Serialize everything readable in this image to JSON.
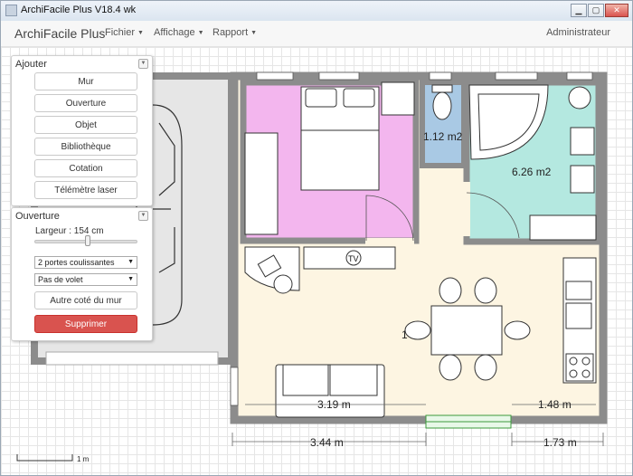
{
  "window": {
    "title": "ArchiFacile Plus V18.4 wk"
  },
  "navbar": {
    "brand": "ArchiFacile Plus",
    "menus": [
      "Fichier",
      "Affichage",
      "Rapport"
    ],
    "user": "Administrateur"
  },
  "panel_ajouter": {
    "title": "Ajouter",
    "buttons": [
      "Mur",
      "Ouverture",
      "Objet",
      "Bibliothèque",
      "Cotation",
      "Télémètre laser"
    ]
  },
  "panel_ouverture": {
    "title": "Ouverture",
    "width_label": "Largeur : 154 cm",
    "width_value_cm": 154,
    "opening_type": "2 portes coulissantes",
    "shutter": "Pas de volet",
    "other_side_button": "Autre coté du mur",
    "delete_button": "Supprimer"
  },
  "plan": {
    "room_areas": {
      "wc": "1.12 m2",
      "bathroom": "6.26 m2"
    },
    "living_area_partial": "1",
    "tv_label": "TV",
    "dimensions": {
      "inner_living": "3.19 m",
      "inner_right": "1.48 m",
      "outer_left": "3.44 m",
      "outer_right": "1.73 m"
    },
    "scale_label": "1 m"
  },
  "colors": {
    "bedroom": "#f3b6ee",
    "wc": "#a9c9e4",
    "bathroom": "#b4e8e0",
    "living": "#fdf5e2",
    "garage": "#e6e6e6",
    "wall": "#8c8c8c",
    "danger": "#d9534f"
  }
}
